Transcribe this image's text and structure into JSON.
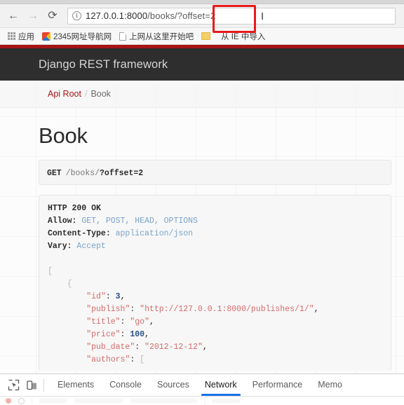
{
  "browser": {
    "nav": {
      "back_label": "←",
      "forward_label": "→",
      "reload_label": "⟳"
    },
    "omnibox": {
      "info_icon_label": "i",
      "url_host": "127.0.0.1:8000",
      "url_path": "/books/?offset=2",
      "url_full": "127.0.0.1:8000/books/?offset=2",
      "caret_label": "I"
    },
    "bookmarks": [
      {
        "icon": "apps-grid-icon",
        "label": "应用"
      },
      {
        "icon": "favicon-2345",
        "label": "2345网址导航网"
      },
      {
        "icon": "favicon-doc",
        "label": "上网从这里开始吧"
      },
      {
        "icon": "favicon-folder",
        "label": ""
      },
      {
        "icon": "none",
        "label": "从 IE 中导入"
      }
    ]
  },
  "annotation": {
    "color": "#e81a1a",
    "target": "offset=2"
  },
  "drf": {
    "brand": "Django REST framework",
    "accent_color": "#a41515",
    "navbar_color": "#2e2e2e",
    "breadcrumb": {
      "root_label": "Api Root",
      "separator": "/",
      "current_label": "Book"
    },
    "page_title": "Book",
    "request": {
      "method": "GET",
      "path_prefix": "/books/",
      "path_query": "?offset=2",
      "full": "GET /books/?offset=2"
    },
    "response": {
      "status_line": "HTTP 200 OK",
      "headers": [
        {
          "name": "Allow:",
          "value": "GET, POST, HEAD, OPTIONS"
        },
        {
          "name": "Content-Type:",
          "value": "application/json"
        },
        {
          "name": "Vary:",
          "value": "Accept"
        }
      ],
      "body_lines": [
        "[",
        "    {",
        "        \"id\": 3,",
        "        \"publish\": \"http://127.0.0.1:8000/publishes/1/\",",
        "        \"title\": \"go\",",
        "        \"price\": 100,",
        "        \"pub_date\": \"2012-12-12\",",
        "        \"authors\": ["
      ],
      "body_fields": [
        {
          "key": "id",
          "value": "3",
          "type": "number"
        },
        {
          "key": "publish",
          "value": "http://127.0.0.1:8000/publishes/1/",
          "type": "string"
        },
        {
          "key": "title",
          "value": "go",
          "type": "string"
        },
        {
          "key": "price",
          "value": "100",
          "type": "number"
        },
        {
          "key": "pub_date",
          "value": "2012-12-12",
          "type": "string"
        },
        {
          "key": "authors",
          "value": "[",
          "type": "array-open"
        }
      ]
    }
  },
  "devtools": {
    "inspect_icon": "inspect-element-icon",
    "device_icon": "device-toolbar-icon",
    "tabs": [
      {
        "label": "Elements",
        "active": false
      },
      {
        "label": "Console",
        "active": false
      },
      {
        "label": "Sources",
        "active": false
      },
      {
        "label": "Network",
        "active": true
      },
      {
        "label": "Performance",
        "active": false
      },
      {
        "label": "Memo",
        "active": false
      }
    ],
    "active_tab": "Network",
    "active_underline_color": "#1a73e8"
  }
}
